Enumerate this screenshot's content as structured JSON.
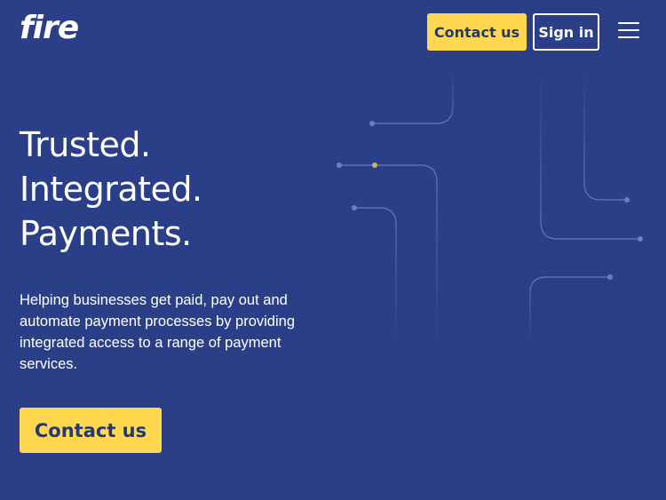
{
  "header": {
    "logo_text": "fire",
    "contact_label": "Contact us",
    "signin_label": "Sign in",
    "menu_icon": "hamburger-menu-icon"
  },
  "hero": {
    "headline_lines": [
      "Trusted.",
      "Integrated.",
      "Payments."
    ],
    "description": "Helping businesses get paid, pay out and automate payment processes by providing integrated access to a range of payment services.",
    "cta_label": "Contact us"
  },
  "colors": {
    "background": "#2b3f88",
    "accent": "#ffd84f",
    "button_text": "#233874",
    "text": "#ffffff"
  }
}
